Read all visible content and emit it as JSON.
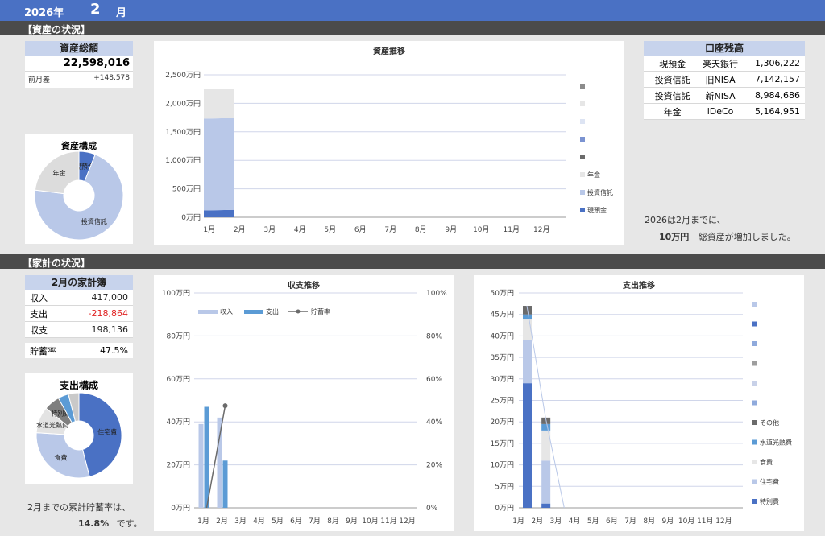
{
  "header": {
    "year": "2026年",
    "month": "2",
    "month_label": "月"
  },
  "section1": {
    "title": "【資産の状況】"
  },
  "section2": {
    "title": "【家計の状況】"
  },
  "total_assets": {
    "label": "資産総額",
    "value": "22,598,016",
    "diff_label": "前月差",
    "diff_value": "+148,578"
  },
  "asset_pie": {
    "title": "資産構成",
    "slices": [
      {
        "name": "現預金",
        "value": 6,
        "color": "#4a71c4"
      },
      {
        "name": "投資信託",
        "value": 71,
        "color": "#b9c8e8"
      },
      {
        "name": "年金",
        "value": 23,
        "color": "#dcdcdc"
      }
    ]
  },
  "accounts": {
    "title": "口座残高",
    "rows": [
      {
        "type": "現預金",
        "name": "楽天銀行",
        "value": "1,306,222"
      },
      {
        "type": "投資信託",
        "name": "旧NISA",
        "value": "7,142,157"
      },
      {
        "type": "投資信託",
        "name": "新NISA",
        "value": "8,984,686"
      },
      {
        "type": "年金",
        "name": "iDeCo",
        "value": "5,164,951"
      }
    ]
  },
  "asset_note": {
    "line1": "2026は2月までに、",
    "amount": "10万円",
    "line2": "総資産が増加しました。"
  },
  "household": {
    "title": "2月の家計簿",
    "rows": [
      {
        "label": "収入",
        "value": "417,000",
        "color": "#222"
      },
      {
        "label": "支出",
        "value": "-218,864",
        "color": "#e02020"
      },
      {
        "label": "収支",
        "value": "198,136",
        "color": "#222"
      }
    ],
    "savings_label": "貯蓄率",
    "savings_value": "47.5%"
  },
  "expense_pie": {
    "title": "支出構成",
    "slices": [
      {
        "name": "住宅費",
        "value": 46,
        "color": "#4a71c4"
      },
      {
        "name": "食費",
        "value": 30,
        "color": "#b9c8e8"
      },
      {
        "name": "水道光熱費",
        "value": 10,
        "color": "#e3e3e3"
      },
      {
        "name": "特別費",
        "value": 6,
        "color": "#7f7f7f"
      },
      {
        "name": "",
        "value": 4,
        "color": "#5b9bd5"
      },
      {
        "name": "",
        "value": 4,
        "color": "#c9c9c9"
      }
    ]
  },
  "savings_note": {
    "line1": "2月までの累計貯蓄率は、",
    "rate": "14.8%",
    "line2": "です。"
  },
  "chart_data": [
    {
      "type": "area",
      "title": "資産推移",
      "categories": [
        "1月",
        "2月",
        "3月",
        "4月",
        "5月",
        "6月",
        "7月",
        "8月",
        "9月",
        "10月",
        "11月",
        "12月"
      ],
      "y_ticks": [
        "0万円",
        "500万円",
        "1,000万円",
        "1,500万円",
        "2,000万円",
        "2,500万円"
      ],
      "ylim": [
        0,
        2500
      ],
      "series": [
        {
          "name": "現預金",
          "color": "#4a71c4",
          "values": [
            120,
            130
          ]
        },
        {
          "name": "投資信託",
          "color": "#b9c8e8",
          "values": [
            1610,
            1613
          ]
        },
        {
          "name": "年金",
          "color": "#e6e6e6",
          "values": [
            520,
            517
          ]
        }
      ],
      "legend_extra_colors": [
        "#8c8c8c",
        "#e6e6e6",
        "#dde4f3",
        "#7b93d1",
        "#6b6b6b"
      ]
    },
    {
      "type": "bar",
      "title": "収支推移",
      "categories": [
        "1月",
        "2月",
        "3月",
        "4月",
        "5月",
        "6月",
        "7月",
        "8月",
        "9月",
        "10月",
        "11月",
        "12月"
      ],
      "y_ticks": [
        "0万円",
        "20万円",
        "40万円",
        "60万円",
        "80万円",
        "100万円"
      ],
      "y2_ticks": [
        "0%",
        "20%",
        "40%",
        "60%",
        "80%",
        "100%"
      ],
      "ylim": [
        0,
        100
      ],
      "y2lim": [
        0,
        100
      ],
      "legend": [
        "収入",
        "支出",
        "貯蓄率"
      ],
      "series": [
        {
          "name": "収入",
          "color": "#b9c8e8",
          "values": [
            39,
            42
          ]
        },
        {
          "name": "支出",
          "color": "#5b9bd5",
          "values": [
            47,
            22
          ]
        },
        {
          "name": "貯蓄率",
          "color": "#6b6b6b",
          "values": [
            0,
            47.5
          ]
        }
      ]
    },
    {
      "type": "bar",
      "title": "支出推移",
      "categories": [
        "1月",
        "2月",
        "3月",
        "4月",
        "5月",
        "6月",
        "7月",
        "8月",
        "9月",
        "10月",
        "11月",
        "12月"
      ],
      "y_ticks": [
        "0万円",
        "5万円",
        "10万円",
        "15万円",
        "20万円",
        "25万円",
        "30万円",
        "35万円",
        "40万円",
        "45万円",
        "50万円"
      ],
      "ylim": [
        0,
        50
      ],
      "series": [
        {
          "name": "特別費",
          "color": "#4a71c4",
          "values": [
            29,
            1
          ]
        },
        {
          "name": "住宅費",
          "color": "#b9c8e8",
          "values": [
            10,
            10
          ]
        },
        {
          "name": "食費",
          "color": "#e6e6e6",
          "values": [
            5,
            7
          ]
        },
        {
          "name": "水道光熱費",
          "color": "#5b9bd5",
          "values": [
            1,
            1.5
          ]
        },
        {
          "name": "その他",
          "color": "#6b6b6b",
          "values": [
            2,
            1.5
          ]
        }
      ],
      "legend_extra_colors": [
        "#b9c8e8",
        "#4a71c4",
        "#8faadc",
        "#9e9e9e",
        "#c8d1e8",
        "#8faadc"
      ]
    }
  ]
}
